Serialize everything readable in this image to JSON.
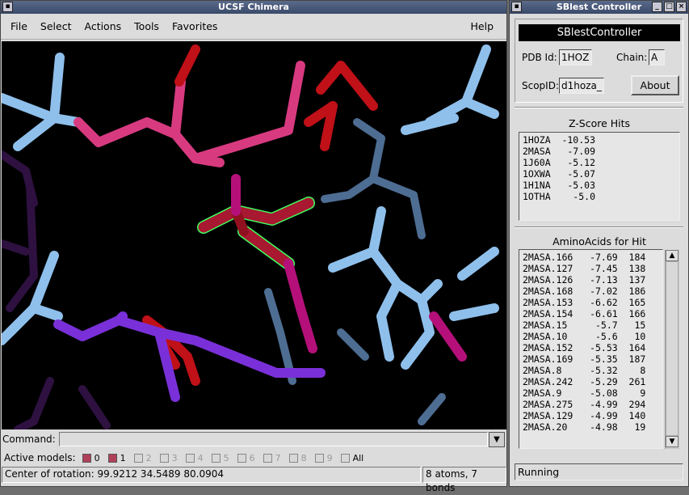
{
  "chimera": {
    "title": "UCSF Chimera",
    "menu": [
      "File",
      "Select",
      "Actions",
      "Tools",
      "Favorites"
    ],
    "help": "Help",
    "command_label": "Command:",
    "command_value": "",
    "active_models_label": "Active models:",
    "models": [
      {
        "n": "0",
        "on": true
      },
      {
        "n": "1",
        "on": true
      },
      {
        "n": "2",
        "on": false
      },
      {
        "n": "3",
        "on": false
      },
      {
        "n": "4",
        "on": false
      },
      {
        "n": "5",
        "on": false
      },
      {
        "n": "6",
        "on": false
      },
      {
        "n": "7",
        "on": false
      },
      {
        "n": "8",
        "on": false
      },
      {
        "n": "9",
        "on": false
      }
    ],
    "all_label": "All",
    "status_left": "Center of rotation: 99.9212 34.5489 80.0904",
    "status_right": "8 atoms, 7 bonds"
  },
  "sblast": {
    "title": "SBlest Controller",
    "header": "SBlestController",
    "pdb_label": "PDB Id:",
    "pdb_value": "1HOZ",
    "chain_label": "Chain:",
    "chain_value": "A",
    "scop_label": "ScopID:",
    "scop_value": "d1hoza_",
    "about_label": "About",
    "zscore_title": "Z-Score Hits",
    "zscore_hits": [
      "1HOZA  -10.53",
      "2MASA   -7.09",
      "1J60A   -5.12",
      "1OXWA   -5.07",
      "1H1NA   -5.03",
      "1OTHA    -5.0"
    ],
    "aa_title": "AminoAcids for Hit",
    "aa_hits": [
      "2MASA.166   -7.69  184",
      "2MASA.127   -7.45  138",
      "2MASA.126   -7.13  137",
      "2MASA.168   -7.02  186",
      "2MASA.153   -6.62  165",
      "2MASA.154   -6.61  166",
      "2MASA.15     -5.7   15",
      "2MASA.10     -5.6   10",
      "2MASA.152   -5.53  164",
      "2MASA.169   -5.35  187",
      "2MASA.8     -5.32    8",
      "2MASA.242   -5.29  261",
      "2MASA.9     -5.08    9",
      "2MASA.275   -4.99  294",
      "2MASA.129   -4.99  140",
      "2MASA.20    -4.98   19"
    ],
    "status": "Running"
  },
  "colors": {
    "light_blue": "#8fc0ec",
    "steel_blue": "#5a7fa8",
    "pink": "#e0407e",
    "red": "#c81020",
    "purple": "#7030d0",
    "magenta": "#b01090",
    "highlight": "#40ff60"
  }
}
